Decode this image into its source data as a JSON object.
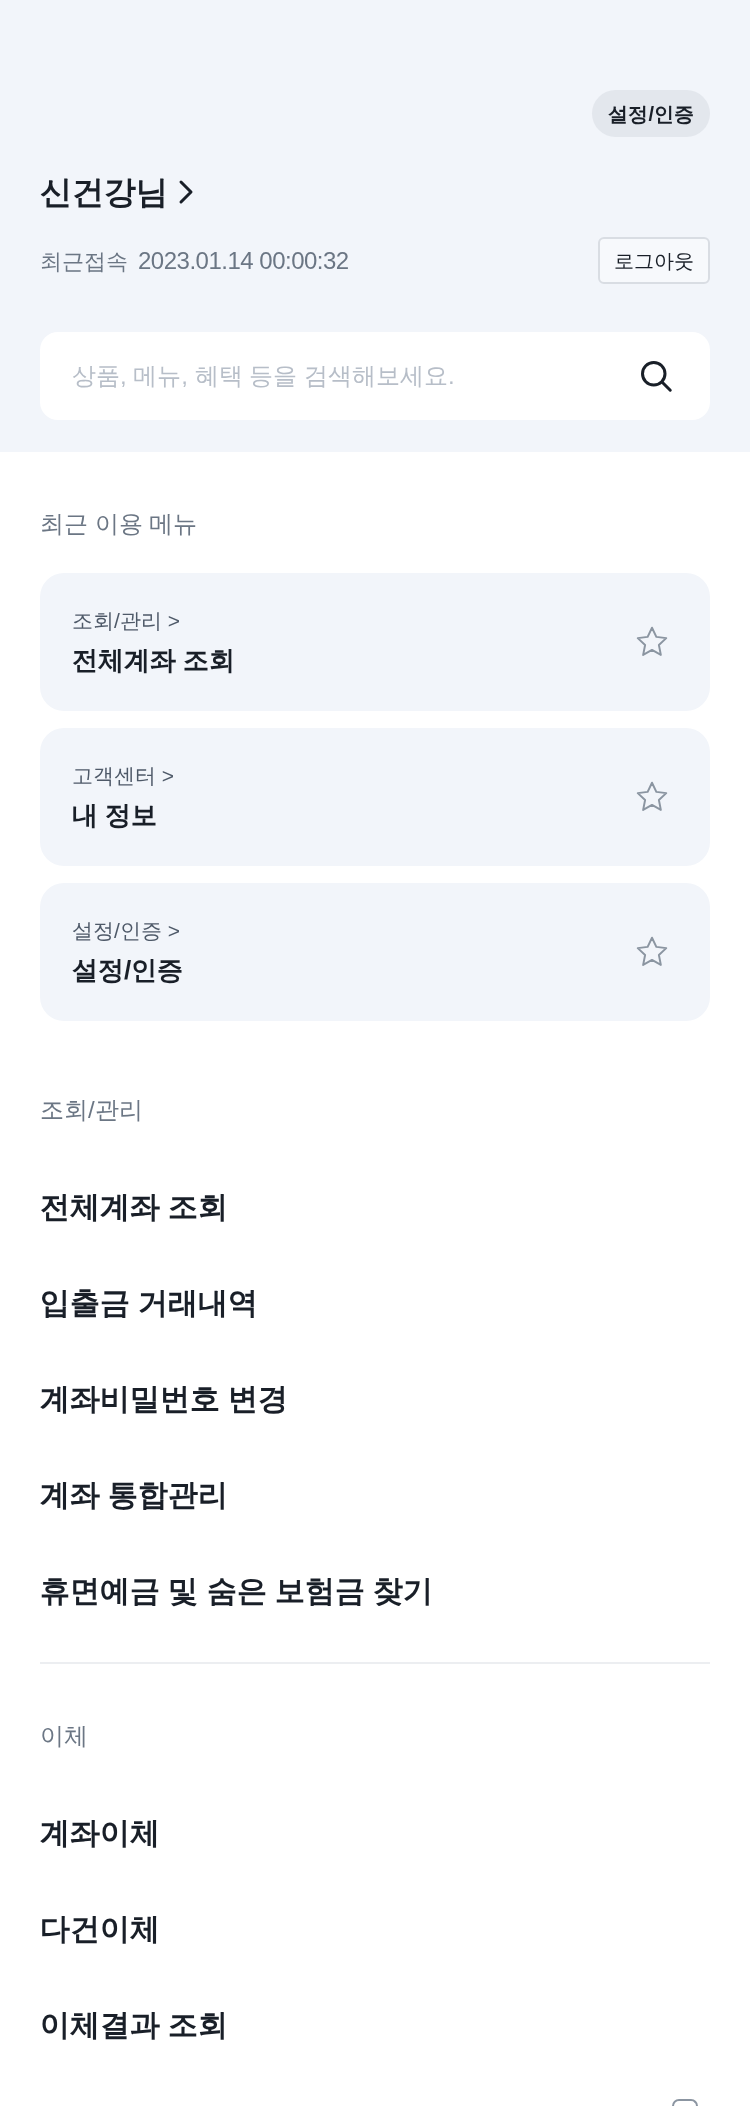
{
  "header": {
    "settings_button": "설정/인증",
    "user_name": "신건강님",
    "last_login_label": "최근접속",
    "last_login_time": "2023.01.14 00:00:32",
    "logout_button": "로그아웃",
    "search": {
      "placeholder": "상품, 메뉴, 혜택 등을 검색해보세요."
    }
  },
  "recent_menu": {
    "title": "최근 이용 메뉴",
    "items": [
      {
        "path": "조회/관리 >",
        "title": "전체계좌 조회",
        "starred": false
      },
      {
        "path": "고객센터 >",
        "title": "내 정보",
        "starred": false
      },
      {
        "path": "설정/인증 >",
        "title": "설정/인증",
        "starred": false
      }
    ]
  },
  "sections": [
    {
      "title": "조회/관리",
      "items": [
        "전체계좌 조회",
        "입출금 거래내역",
        "계좌비밀번호 변경",
        "계좌 통합관리",
        "휴면예금 및 숨은 보험금 찾기"
      ]
    },
    {
      "title": "이체",
      "items": [
        "계좌이체",
        "다건이체",
        "이체결과 조회"
      ]
    }
  ]
}
